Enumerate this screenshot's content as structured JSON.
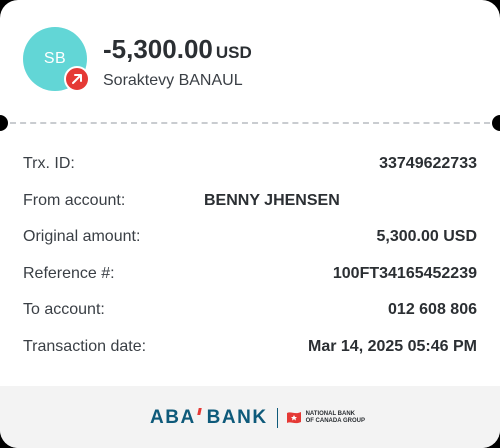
{
  "header": {
    "avatar_initials": "SB",
    "amount": "-5,300.00",
    "currency": "USD",
    "counterparty_name": "Soraktevy BANAUL",
    "avatar_color": "#62d6d6",
    "badge_color": "#e53935",
    "badge_icon": "outgoing-arrow-icon"
  },
  "details": [
    {
      "label": "Trx. ID:",
      "value": "33749622733"
    },
    {
      "label": "From account:",
      "value": "BENNY JHENSEN"
    },
    {
      "label": "Original amount:",
      "value": "5,300.00 USD"
    },
    {
      "label": "Reference #:",
      "value": "100FT34165452239"
    },
    {
      "label": "To account:",
      "value": "012 608 806"
    },
    {
      "label": "Transaction date:",
      "value": "Mar 14, 2025 05:46 PM"
    }
  ],
  "footer": {
    "brand_name": "ABA BANK",
    "partner_line1": "NATIONAL BANK",
    "partner_line2": "OF CANADA GROUP",
    "brand_color": "#0e5a7a",
    "partner_color": "#e53935"
  }
}
